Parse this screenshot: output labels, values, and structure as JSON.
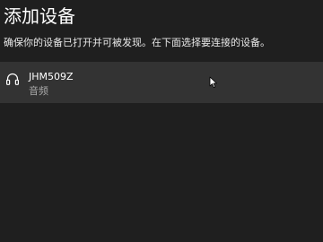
{
  "dialog": {
    "title": "添加设备",
    "instructions": "确保你的设备已打开并可被发现。在下面选择要连接的设备。"
  },
  "devices": [
    {
      "name": "JHM509Z",
      "type": "音频",
      "icon": "headphones-icon"
    }
  ],
  "colors": {
    "background": "#1f1f1f",
    "item_hover": "#333333",
    "text_primary": "#ffffff",
    "text_secondary": "#a8a8a8"
  }
}
